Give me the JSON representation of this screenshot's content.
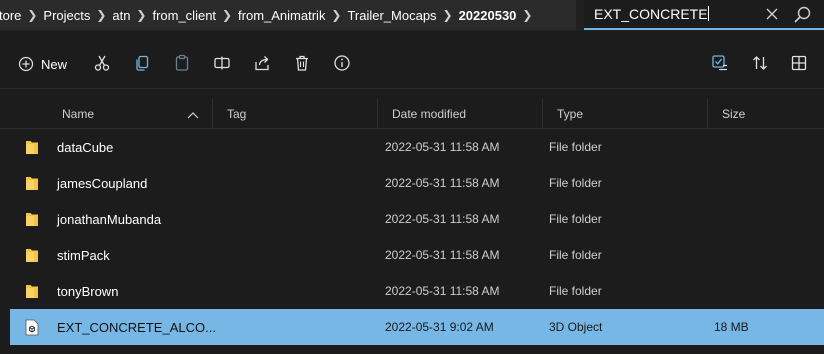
{
  "breadcrumb": [
    "tore",
    "Projects",
    "atn",
    "from_client",
    "from_Animatrik",
    "Trailer_Mocaps",
    "20220530"
  ],
  "search": {
    "value": "EXT_CONCRETE"
  },
  "toolbar": {
    "new_label": "New"
  },
  "columns": {
    "name": "Name",
    "tag": "Tag",
    "date": "Date modified",
    "type": "Type",
    "size": "Size"
  },
  "files": [
    {
      "name": "dataCube",
      "date": "2022-05-31 11:58 AM",
      "type": "File folder",
      "size": "",
      "icon": "folder-icon"
    },
    {
      "name": "jamesCoupland",
      "date": "2022-05-31 11:58 AM",
      "type": "File folder",
      "size": "",
      "icon": "folder-icon"
    },
    {
      "name": "jonathanMubanda",
      "date": "2022-05-31 11:58 AM",
      "type": "File folder",
      "size": "",
      "icon": "folder-icon"
    },
    {
      "name": "stimPack",
      "date": "2022-05-31 11:58 AM",
      "type": "File folder",
      "size": "",
      "icon": "folder-icon"
    },
    {
      "name": "tonyBrown",
      "date": "2022-05-31 11:58 AM",
      "type": "File folder",
      "size": "",
      "icon": "folder-icon"
    },
    {
      "name": "EXT_CONCRETE_ALCO...",
      "date": "2022-05-31 9:02 AM",
      "type": "3D Object",
      "size": "18 MB",
      "icon": "3d-object-file-icon"
    }
  ],
  "colors": {
    "selection": "#77b7e6",
    "search_underline": "#6fb6e8",
    "folder": "#f3c445"
  }
}
